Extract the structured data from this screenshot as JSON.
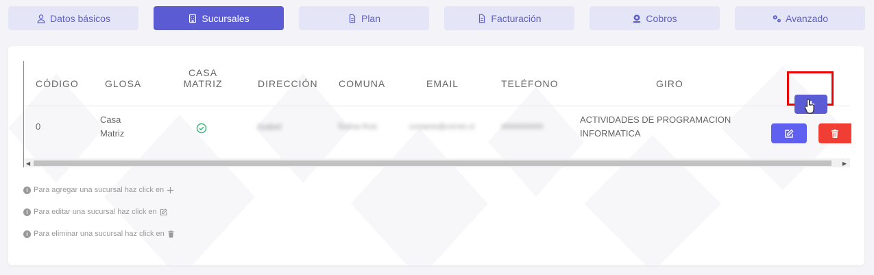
{
  "tabs": [
    {
      "label": "Datos básicos",
      "icon": "user-icon",
      "active": false
    },
    {
      "label": "Sucursales",
      "icon": "building-icon",
      "active": true
    },
    {
      "label": "Plan",
      "icon": "document-icon",
      "active": false
    },
    {
      "label": "Facturación",
      "icon": "document-icon",
      "active": false
    },
    {
      "label": "Cobros",
      "icon": "coins-icon",
      "active": false
    },
    {
      "label": "Avanzado",
      "icon": "gears-icon",
      "active": false
    }
  ],
  "table": {
    "headers": {
      "codigo": "CÓDIGO",
      "glosa": "GLOSA",
      "casa_matriz_1": "CASA",
      "casa_matriz_2": "MATRIZ",
      "direccion": "DIRECCIÓN",
      "comuna": "COMUNA",
      "email": "EMAIL",
      "telefono": "TELÉFONO",
      "giro": "GIRO"
    },
    "rows": [
      {
        "codigo": "0",
        "glosa_1": "Casa",
        "glosa_2": "Matriz",
        "casa_matriz": true,
        "direccion": "Isabel",
        "comuna": "Ñuñoa Ruiz",
        "email": "contacto@correo.cl",
        "telefono": "9999999999",
        "giro_1": "ACTIVIDADES DE PROGRAMACION",
        "giro_2": "INFORMATICA"
      }
    ]
  },
  "help": {
    "add": "Para agregar una sucursal haz click en",
    "edit": "Para editar una sucursal haz click en",
    "delete": "Para eliminar una sucursal haz click en"
  },
  "colors": {
    "primary": "#5b5cd3",
    "danger": "#f03e35",
    "highlight": "#ee0000"
  }
}
